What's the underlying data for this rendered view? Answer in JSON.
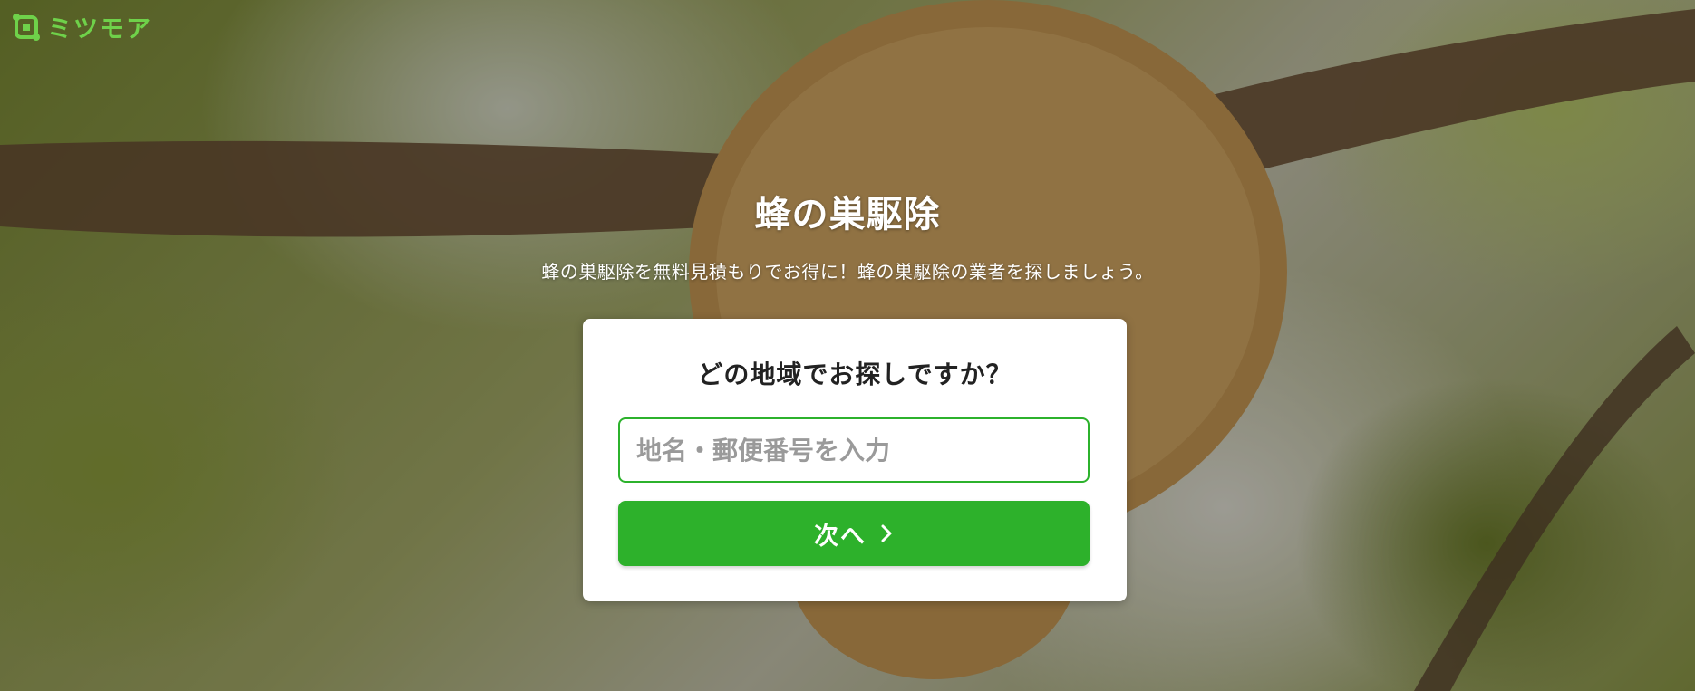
{
  "brand": {
    "logo_text": "ミツモア",
    "logo_color": "#6fd14a"
  },
  "hero": {
    "title": "蜂の巣駆除",
    "subtitle": "蜂の巣駆除を無料見積もりでお得に！蜂の巣駆除の業者を探しましょう。"
  },
  "search": {
    "question": "どの地域でお探しですか？",
    "input_placeholder": "地名・郵便番号を入力",
    "input_value": "",
    "next_label": "次へ",
    "next_icon": "chevron-right-icon"
  },
  "colors": {
    "accent": "#2db12b",
    "input_border": "#2cb22c"
  }
}
